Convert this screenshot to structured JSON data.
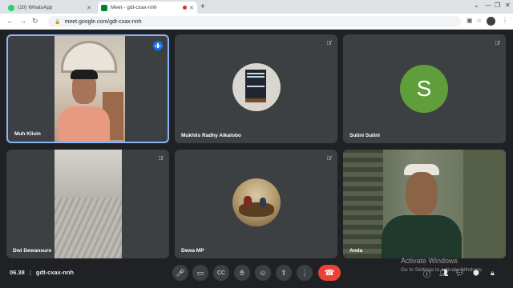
{
  "browser": {
    "tabs": [
      {
        "title": "(10) WhatsApp",
        "active": false,
        "favicon_color": "#25d366"
      },
      {
        "title": "Meet - gdt-cxax-nnh",
        "active": true,
        "favicon_color": "#00832d"
      }
    ],
    "url": "meet.google.com/gdt-cxax-nnh"
  },
  "participants": [
    {
      "name": "Muh Klisin",
      "speaking": true
    },
    {
      "name": "Mukhlis Radhy Alkalobo",
      "muted": true
    },
    {
      "name": "Sutini Sutini",
      "initial": "S",
      "avatar_color": "#5f9e3a",
      "muted": true
    },
    {
      "name": "Dwi Dewansuro",
      "muted": true
    },
    {
      "name": "Dewa MP",
      "muted": true
    },
    {
      "name": "Anda"
    }
  ],
  "meeting": {
    "time": "06.38",
    "separator": "|",
    "code": "gdt-cxax-nnh"
  },
  "watermark": {
    "title": "Activate Windows",
    "subtitle": "Go to Settings to activate Windows."
  }
}
